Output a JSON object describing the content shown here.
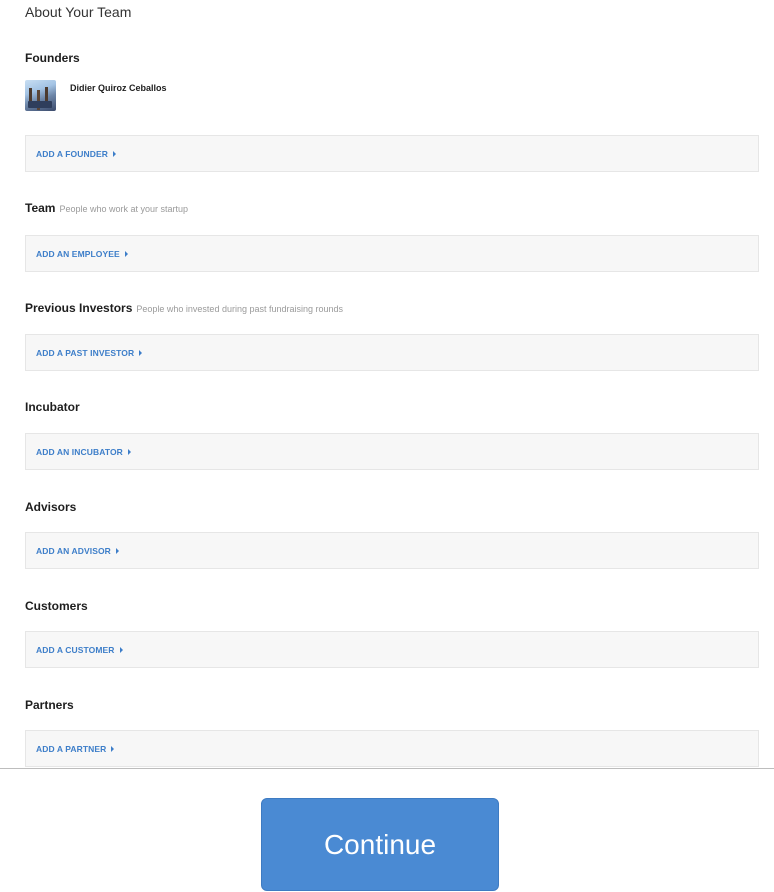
{
  "page_title": "About Your Team",
  "founders": {
    "title": "Founders",
    "members": [
      {
        "name": "Didier Quiroz Ceballos"
      }
    ],
    "add_label": "ADD A FOUNDER"
  },
  "team": {
    "title": "Team",
    "hint": "People who work at your startup",
    "add_label": "ADD AN EMPLOYEE"
  },
  "previous_investors": {
    "title": "Previous Investors",
    "hint": "People who invested during past fundraising rounds",
    "add_label": "ADD A PAST INVESTOR"
  },
  "incubator": {
    "title": "Incubator",
    "add_label": "ADD AN INCUBATOR"
  },
  "advisors": {
    "title": "Advisors",
    "add_label": "ADD AN ADVISOR"
  },
  "customers": {
    "title": "Customers",
    "add_label": "ADD A CUSTOMER"
  },
  "partners": {
    "title": "Partners",
    "add_label": "ADD A PARTNER"
  },
  "continue_label": "Continue",
  "colors": {
    "link": "#3d7ec9",
    "button": "#4a8ad3"
  },
  "icons": {
    "add_link": "caret-right-icon"
  }
}
